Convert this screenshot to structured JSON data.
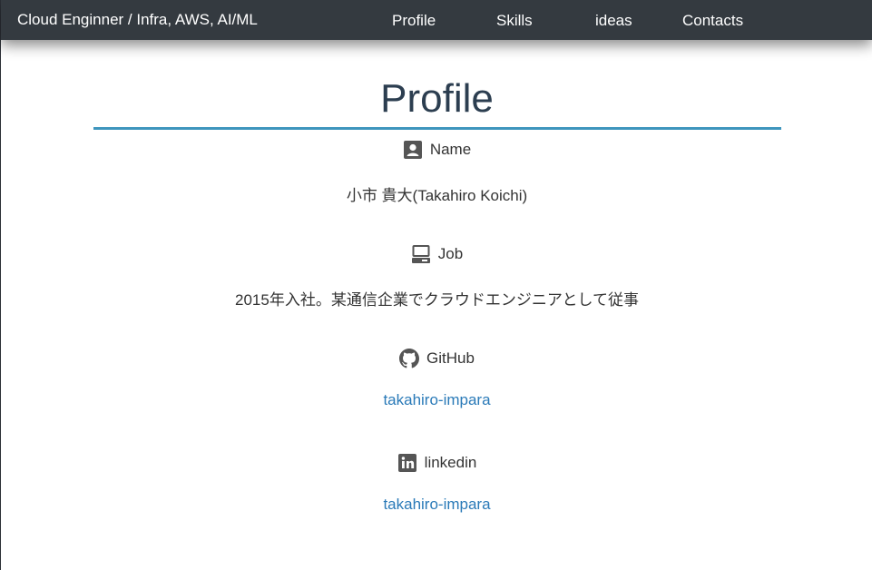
{
  "navbar": {
    "brand": "Cloud Enginner / Infra, AWS, AI/ML",
    "links": [
      "Profile",
      "Skills",
      "ideas",
      "Contacts"
    ]
  },
  "profile": {
    "title": "Profile",
    "sections": [
      {
        "icon": "contact-card-icon",
        "label": "Name",
        "value": "小市 貴大(Takahiro Koichi)"
      },
      {
        "icon": "laptop-icon",
        "label": "Job",
        "value": "2015年入社。某通信企業でクラウドエンジニアとして従事"
      },
      {
        "icon": "github-icon",
        "label": "GitHub",
        "value": "takahiro-impara"
      },
      {
        "icon": "linkedin-icon",
        "label": "linkedin",
        "value": "takahiro-impara"
      }
    ]
  },
  "colors": {
    "navbar": "#343a40",
    "accent_rule": "#3e95bd",
    "link": "#2a7ab8",
    "heading": "#2c3e50"
  }
}
